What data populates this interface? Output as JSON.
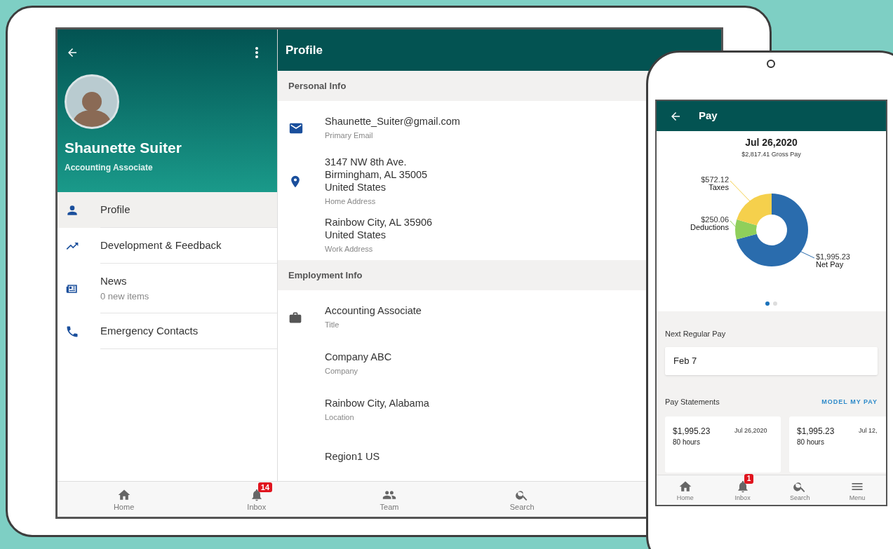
{
  "tablet": {
    "drawer": {
      "name": "Shaunette Suiter",
      "role": "Accounting Associate",
      "items": [
        {
          "label": "Profile",
          "kind": "person",
          "selected": true
        },
        {
          "label": "Development & Feedback",
          "kind": "trend",
          "selected": false
        },
        {
          "label": "News",
          "sublabel": "0 new items",
          "kind": "news",
          "selected": false
        },
        {
          "label": "Emergency Contacts",
          "kind": "phone",
          "selected": false
        }
      ]
    },
    "profile": {
      "title": "Profile",
      "sections": [
        {
          "heading": "Personal Info",
          "fields": [
            {
              "kind": "mail",
              "lines": [
                "Shaunette_Suiter@gmail.com"
              ],
              "label": "Primary Email"
            },
            {
              "kind": "pin",
              "lines": [
                "3147 NW 8th Ave.",
                "Birmingham, AL 35005",
                "United States"
              ],
              "label": "Home Address"
            },
            {
              "kind": "plain",
              "lines": [
                "Rainbow City, AL 35906",
                "United States"
              ],
              "label": "Work Address"
            }
          ]
        },
        {
          "heading": "Employment Info",
          "fields": [
            {
              "kind": "briefcase",
              "lines": [
                "Accounting Associate"
              ],
              "label": "Title"
            },
            {
              "kind": "plain",
              "lines": [
                "Company ABC"
              ],
              "label": "Company"
            },
            {
              "kind": "plain",
              "lines": [
                "Rainbow City, Alabama"
              ],
              "label": "Location"
            },
            {
              "kind": "plain",
              "lines": [
                "Region1 US"
              ]
            }
          ]
        }
      ]
    },
    "bottom_nav": [
      {
        "label": "Home",
        "kind": "home"
      },
      {
        "label": "Inbox",
        "kind": "bell",
        "badge": "14"
      },
      {
        "label": "Team",
        "kind": "team"
      },
      {
        "label": "Search",
        "kind": "search"
      }
    ]
  },
  "phone": {
    "title": "Pay",
    "pay_date": "Jul 26,2020",
    "gross_pay": "$2,817.41 Gross Pay",
    "chart_data": {
      "type": "donut",
      "categories": [
        "Net Pay",
        "Deductions",
        "Taxes"
      ],
      "values": [
        1995.23,
        250.06,
        572.12
      ],
      "value_labels": [
        "$1,995.23",
        "$250.06",
        "$572.12"
      ]
    },
    "pager": [
      {
        "selected": true
      },
      {
        "selected": false
      }
    ],
    "next_pay": {
      "label": "Next Regular Pay",
      "value": "Feb 7"
    },
    "statements": {
      "heading": "Pay Statements",
      "action": "MODEL MY PAY",
      "cards": [
        {
          "amount": "$1,995.23",
          "hours": "80 hours",
          "date": "Jul 26,2020"
        },
        {
          "amount": "$1,995.23",
          "hours": "80 hours",
          "date": "Jul 12,"
        }
      ]
    },
    "bottom_nav": [
      {
        "label": "Home",
        "kind": "home"
      },
      {
        "label": "Inbox",
        "kind": "bell",
        "badge": "1"
      },
      {
        "label": "Search",
        "kind": "search"
      },
      {
        "label": "Menu",
        "kind": "menu"
      }
    ]
  }
}
